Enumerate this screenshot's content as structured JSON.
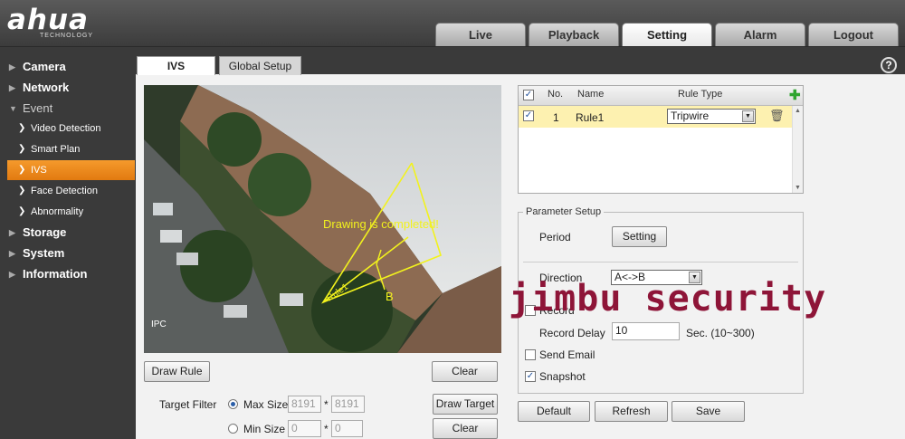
{
  "header": {
    "logo_text": "a‌hua",
    "logo_sub": "TECHNOLOGY",
    "tabs": [
      "Live",
      "Playback",
      "Setting",
      "Alarm",
      "Logout"
    ]
  },
  "sidebar": {
    "items": [
      {
        "label": "Camera"
      },
      {
        "label": "Network"
      },
      {
        "label": "Event"
      },
      {
        "label": "Video Detection"
      },
      {
        "label": "Smart Plan"
      },
      {
        "label": "IVS"
      },
      {
        "label": "Face Detection"
      },
      {
        "label": "Abnormality"
      },
      {
        "label": "Storage"
      },
      {
        "label": "System"
      },
      {
        "label": "Information"
      }
    ]
  },
  "subtabs": [
    "IVS",
    "Global Setup"
  ],
  "help": "?",
  "video": {
    "overlay_text": "Drawing is completed!",
    "corner_label": "IPC",
    "rule_label": "Rule1",
    "point_label": "B"
  },
  "buttons": {
    "draw_rule": "Draw Rule",
    "clear_1": "Clear",
    "draw_target": "Draw Target",
    "clear_2": "Clear",
    "default": "Default",
    "refresh": "Refresh",
    "save": "Save",
    "setting": "Setting"
  },
  "target_filter": {
    "label": "Target Filter",
    "max_label": "Max Size",
    "max_w": "8191",
    "max_h": "8191",
    "min_label": "Min Size",
    "min_w": "0",
    "min_h": "0",
    "sep": "*"
  },
  "rule_table": {
    "headers": {
      "no": "No.",
      "name": "Name",
      "type": "Rule Type"
    },
    "row": {
      "no": "1",
      "name": "Rule1",
      "type": "Tripwire"
    }
  },
  "params": {
    "legend": "Parameter Setup",
    "period": "Period",
    "direction": "Direction",
    "direction_value": "A<->B",
    "record": "Record",
    "record_delay": "Record Delay",
    "record_delay_value": "10",
    "record_delay_unit": "Sec. (10~300)",
    "send_email": "Send Email",
    "snapshot": "Snapshot"
  },
  "watermark": "jimbu security",
  "colors": {
    "accent": "#ef8a1e",
    "watermark": "#8e1538",
    "highlight_row": "#fdf1b0"
  }
}
